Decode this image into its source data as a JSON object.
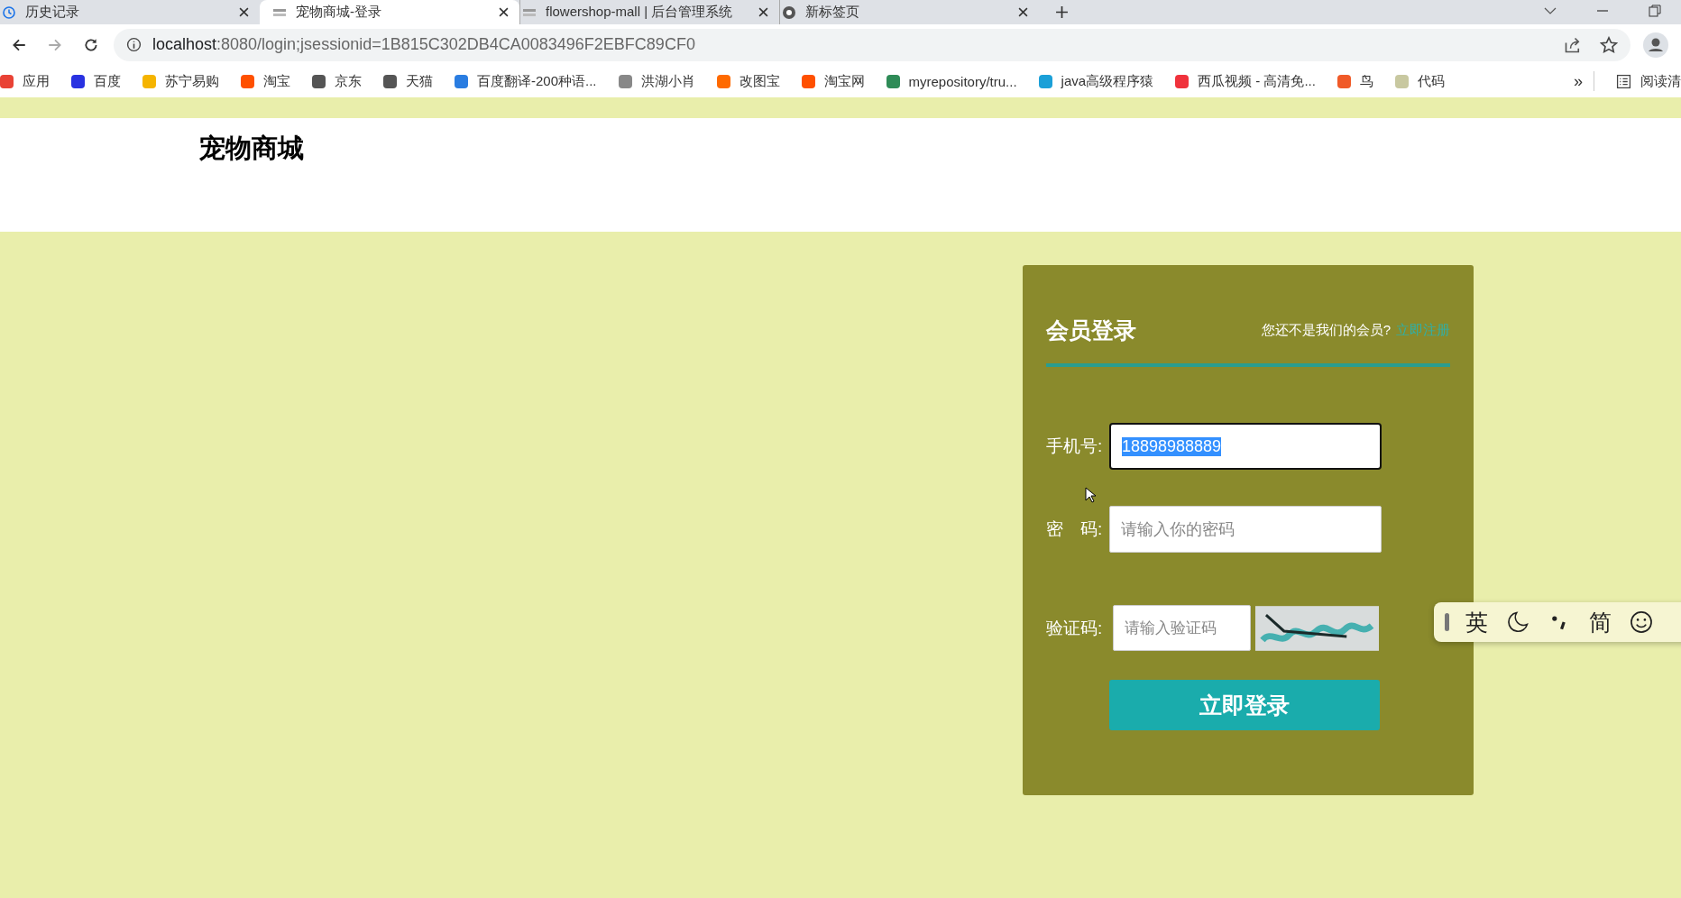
{
  "browser": {
    "tabs": [
      {
        "title": "历史记录",
        "selected": false,
        "kind": "history"
      },
      {
        "title": "宠物商城-登录",
        "selected": true,
        "kind": "site"
      },
      {
        "title": "flowershop-mall | 后台管理系统",
        "selected": false,
        "kind": "site"
      },
      {
        "title": "新标签页",
        "selected": false,
        "kind": "chrome"
      }
    ],
    "url_host": "localhost",
    "url_rest": ":8080/login;jsessionid=1B815C302DB4CA0083496F2EBFC89CF0",
    "bookmarks": [
      {
        "label": "应用",
        "color": "#e94235"
      },
      {
        "label": "百度",
        "color": "#2932e1"
      },
      {
        "label": "苏宁易购",
        "color": "#f5b400"
      },
      {
        "label": "淘宝",
        "color": "#ff5000"
      },
      {
        "label": "京东",
        "color": "#555555"
      },
      {
        "label": "天猫",
        "color": "#555555"
      },
      {
        "label": "百度翻译-200种语...",
        "color": "#2a7de1"
      },
      {
        "label": "洪湖小肖",
        "color": "#888888"
      },
      {
        "label": "改图宝",
        "color": "#ff6a00"
      },
      {
        "label": "淘宝网",
        "color": "#ff5000"
      },
      {
        "label": "myrepository/tru...",
        "color": "#2e8b57"
      },
      {
        "label": "java高级程序猿",
        "color": "#1ba0d8"
      },
      {
        "label": "西瓜视频 - 高清免...",
        "color": "#f0323c"
      },
      {
        "label": "鸟",
        "color": "#f05a28"
      },
      {
        "label": "代码",
        "color": "#c8c8a0"
      }
    ],
    "more": "»",
    "reading_mode": "阅读清"
  },
  "site": {
    "title": "宠物商城"
  },
  "login": {
    "title": "会员登录",
    "prompt": "您还不是我们的会员?",
    "register_link": "立即注册",
    "fields": [
      {
        "label": "手机号:",
        "value": "18898988889",
        "value_selected": true,
        "focused": true,
        "kind": "text"
      },
      {
        "label": "密　码:",
        "placeholder": "请输入你的密码",
        "focused": false,
        "kind": "text"
      },
      {
        "label": "验证码:",
        "placeholder": "请输入验证码",
        "focused": false,
        "kind": "captcha"
      }
    ],
    "submit": "立即登录"
  },
  "ime_toolbar": {
    "items": [
      "英",
      "简"
    ]
  }
}
